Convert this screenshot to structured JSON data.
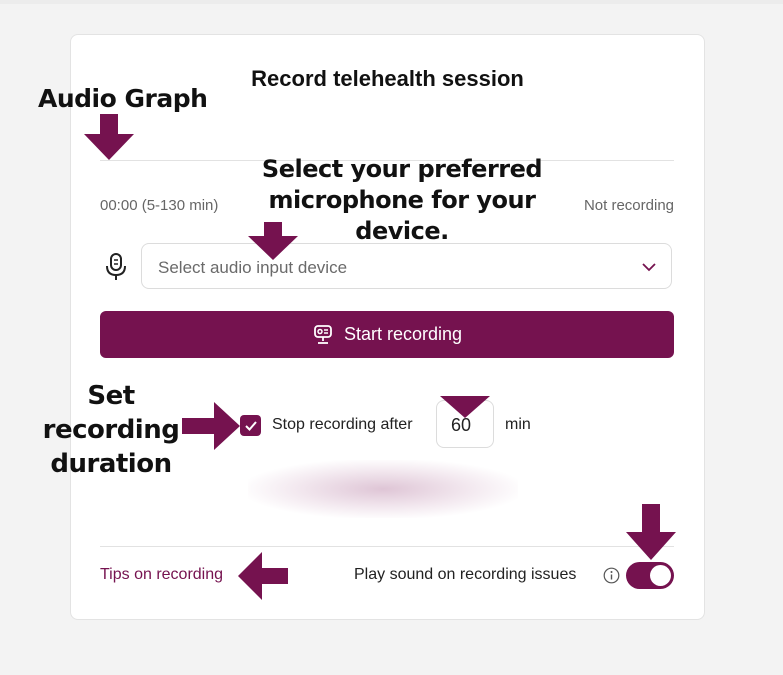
{
  "card": {
    "title": "Record telehealth session",
    "timer": "00:00 (5-130 min)",
    "status": "Not recording",
    "device_select": {
      "placeholder": "Select audio input device",
      "selected": null
    },
    "start_button_label": "Start recording",
    "stop_after": {
      "checked": true,
      "label": "Stop recording after",
      "value": "60",
      "unit": "min"
    },
    "tips_link": "Tips on recording",
    "sound_toggle": {
      "label": "Play sound on recording issues",
      "on": true
    }
  },
  "annotations": {
    "audio_graph": "Audio Graph",
    "microphone_line1": "Select your preferred",
    "microphone_line2": "microphone for your device.",
    "duration_line1": "Set recording",
    "duration_line2": "duration"
  },
  "icons": [
    "microphone-icon",
    "chevron-down-icon",
    "recorder-icon",
    "checkmark-icon",
    "info-icon"
  ],
  "colors": {
    "accent": "#75124f",
    "background": "#f3f3f3",
    "card": "#ffffff",
    "annotation_arrow": "#75124f"
  }
}
